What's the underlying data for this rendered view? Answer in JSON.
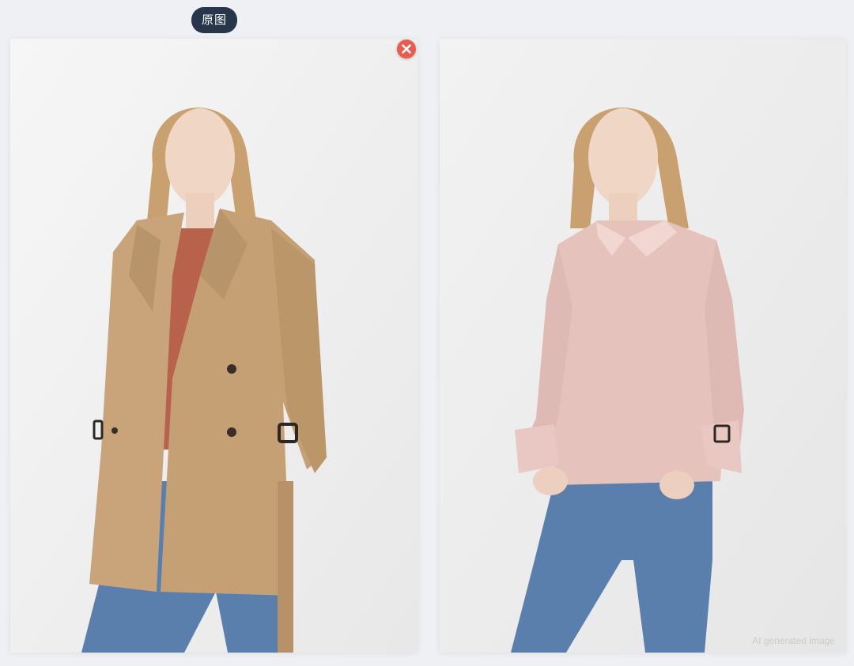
{
  "original_label": "原图",
  "watermark": "AI generated image",
  "colors": {
    "pill_bg": "#27364a",
    "close_bg": "#ea5a4f",
    "trench_coat": "#c9a47b",
    "inner_top": "#b9624b",
    "blouse": "#e6c2bd",
    "jeans": "#5b7fad"
  },
  "icons": {
    "close": "close-icon"
  }
}
